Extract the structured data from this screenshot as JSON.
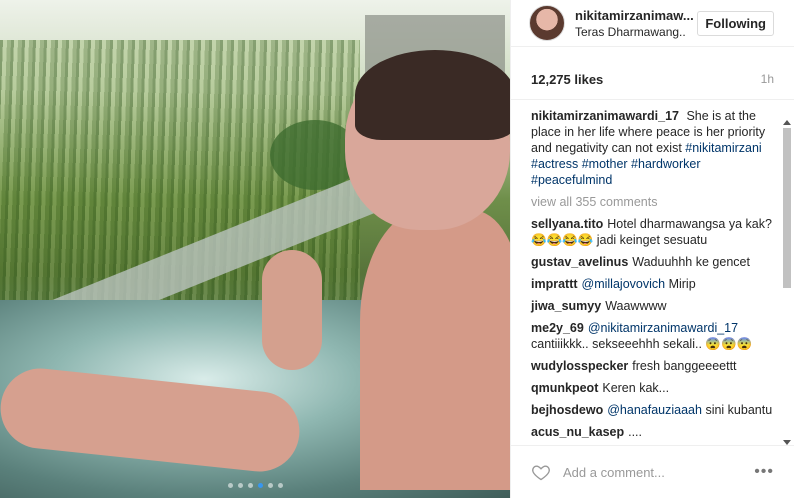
{
  "post": {
    "username": "nikitamirzanimaw...",
    "location": "Teras Dharmawang..",
    "follow_label": "Following",
    "likes": "12,275 likes",
    "time": "1h",
    "caption": {
      "user": "nikitamirzanimawardi_17",
      "text": "She is at the place in her life where peace is her priority and negativity can not exist",
      "hashtags": "#nikitamirzani #actress #mother #hardworker #peacefulmind"
    },
    "view_all": "view all 355 comments",
    "comments": [
      {
        "user": "sellyana.tito",
        "text": "Hotel dharmawangsa ya kak? 😂😂😂😂 jadi keinget sesuatu",
        "mention": ""
      },
      {
        "user": "gustav_avelinus",
        "text": "Waduuhhh ke gencet",
        "mention": ""
      },
      {
        "user": "imprattt",
        "text": "Mirip",
        "mention": "@millajovovich"
      },
      {
        "user": "jiwa_sumyy",
        "text": "Waawwww",
        "mention": ""
      },
      {
        "user": "me2y_69",
        "text": "cantiiikkk.. sekseeehhh sekali.. 😨😨😨",
        "mention": "@nikitamirzanimawardi_17"
      },
      {
        "user": "wudylosspecker",
        "text": "fresh banggeeeettt",
        "mention": ""
      },
      {
        "user": "qmunkpeot",
        "text": "Keren kak...",
        "mention": ""
      },
      {
        "user": "bejhosdewo",
        "text": "sini kubantu",
        "mention": "@hanafauziaaah"
      },
      {
        "user": "acus_nu_kasep",
        "text": "....",
        "mention": ""
      }
    ],
    "add_comment_placeholder": "Add a comment...",
    "more_label": "•••",
    "carousel": {
      "total": 6,
      "active_index": 3
    }
  },
  "colors": {
    "link": "#003569",
    "accent": "#3897f0",
    "muted": "#999999"
  },
  "icons": {
    "like": "heart-outline-icon",
    "options": "more-options-icon"
  }
}
